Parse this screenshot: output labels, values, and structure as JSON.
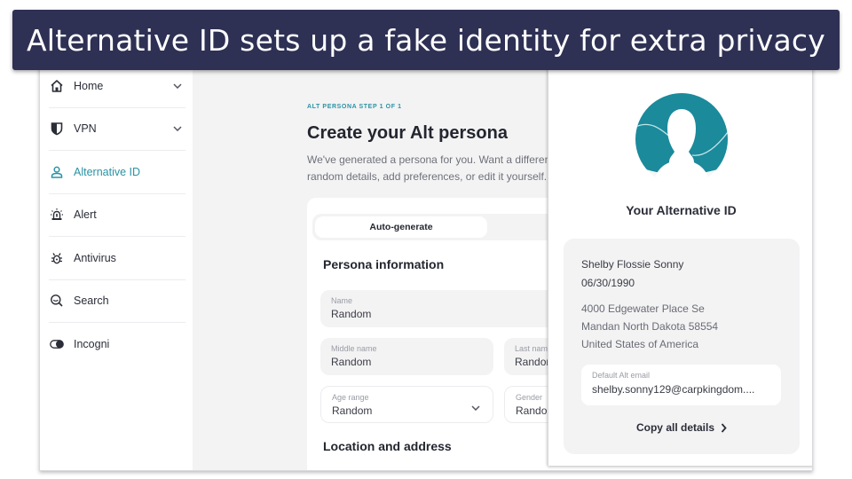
{
  "banner": {
    "title": "Alternative ID sets up a fake identity for extra privacy"
  },
  "sidebar": {
    "items": [
      {
        "label": "Home",
        "icon": "home-icon",
        "expandable": true,
        "active": false
      },
      {
        "label": "VPN",
        "icon": "shield-icon",
        "expandable": true,
        "active": false
      },
      {
        "label": "Alternative ID",
        "icon": "user-icon",
        "expandable": false,
        "active": true
      },
      {
        "label": "Alert",
        "icon": "alarm-icon",
        "expandable": false,
        "active": false
      },
      {
        "label": "Antivirus",
        "icon": "bug-icon",
        "expandable": false,
        "active": false
      },
      {
        "label": "Search",
        "icon": "search-icon",
        "expandable": false,
        "active": false
      },
      {
        "label": "Incogni",
        "icon": "toggle-icon",
        "expandable": false,
        "active": false
      }
    ]
  },
  "main": {
    "step_label": "ALT PERSONA STEP 1 OF 1",
    "title": "Create your Alt persona",
    "description_line1": "We've generated a persona for you. Want a different",
    "description_line2": "random details, add preferences, or edit it yourself.",
    "segment": {
      "active_label": "Auto-generate"
    },
    "persona_section_title": "Persona information",
    "fields": {
      "name": {
        "label": "Name",
        "value": "Random"
      },
      "middle_name": {
        "label": "Middle name",
        "value": "Random"
      },
      "last_name": {
        "label": "Last name",
        "value": "Random"
      },
      "age_range": {
        "label": "Age range",
        "value": "Random"
      },
      "gender": {
        "label": "Gender",
        "value": "Random"
      }
    },
    "location_section_title": "Location and address"
  },
  "panel": {
    "title": "Your Alternative ID",
    "full_name": "Shelby Flossie Sonny",
    "dob": "06/30/1990",
    "address_line1": "4000 Edgewater Place Se",
    "address_line2": "Mandan North Dakota 58554",
    "address_line3": "United States of America",
    "email_label": "Default Alt email",
    "email_value": "shelby.sonny129@carpkingdom....",
    "copy_label": "Copy all details"
  },
  "colors": {
    "banner_bg": "#2e3054",
    "accent_teal": "#2a93a4",
    "avatar_teal": "#1b8a9b",
    "panel_grey": "#f3f3f4"
  }
}
